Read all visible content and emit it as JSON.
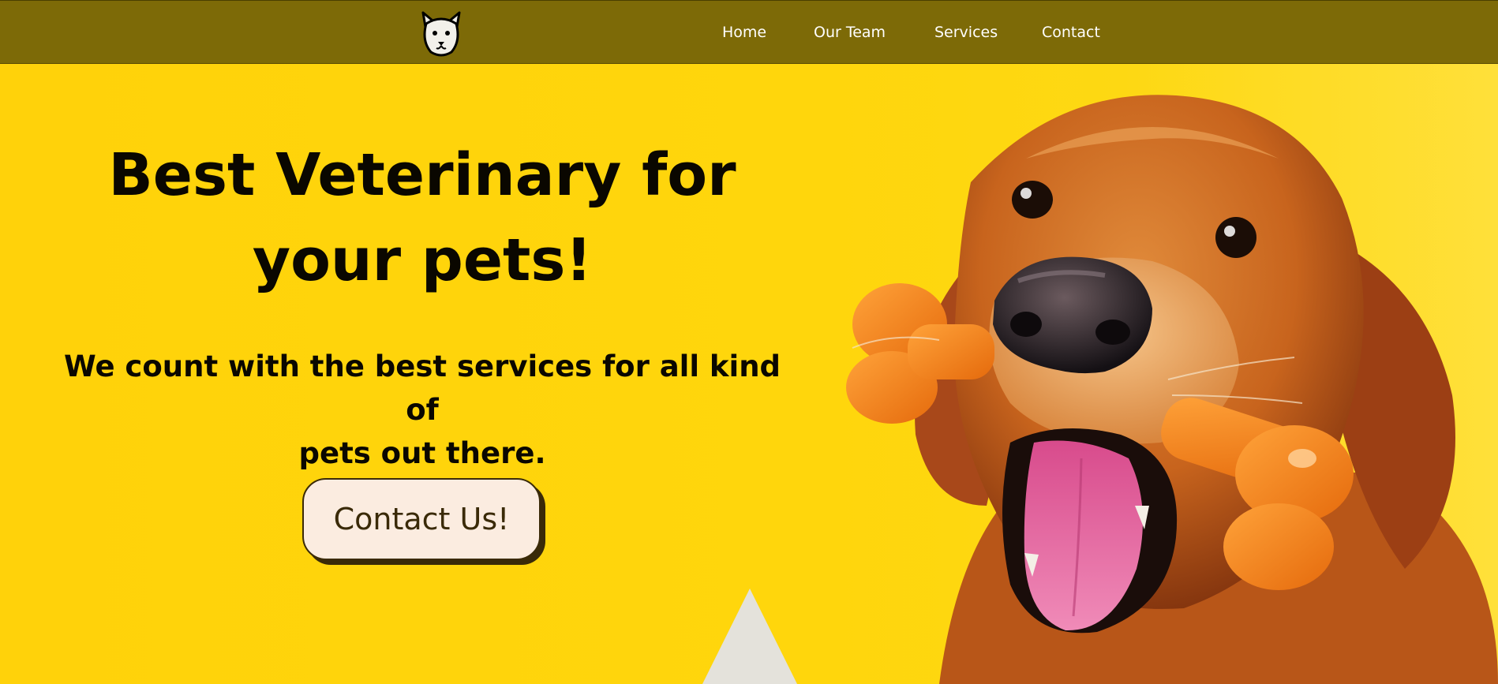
{
  "nav": {
    "logo_icon": "dog-face-icon",
    "links": [
      {
        "label": "Home"
      },
      {
        "label": "Our Team"
      },
      {
        "label": "Services"
      },
      {
        "label": "Contact"
      }
    ]
  },
  "hero": {
    "title_line1": "Best Veterinary for",
    "title_line2": "your pets!",
    "subtitle_line1": "We count with the best services for all kind of",
    "subtitle_line2": "pets out there.",
    "cta_label": "Contact Us!",
    "image_subject": "golden-retriever-with-orange-bone-toy"
  },
  "colors": {
    "nav_background": "#7d6a07",
    "hero_background": "#ffd60c",
    "text": "#0a0700",
    "button_background": "#fbece0",
    "button_text": "#3a2a08",
    "triangle": "#e4e2db"
  }
}
